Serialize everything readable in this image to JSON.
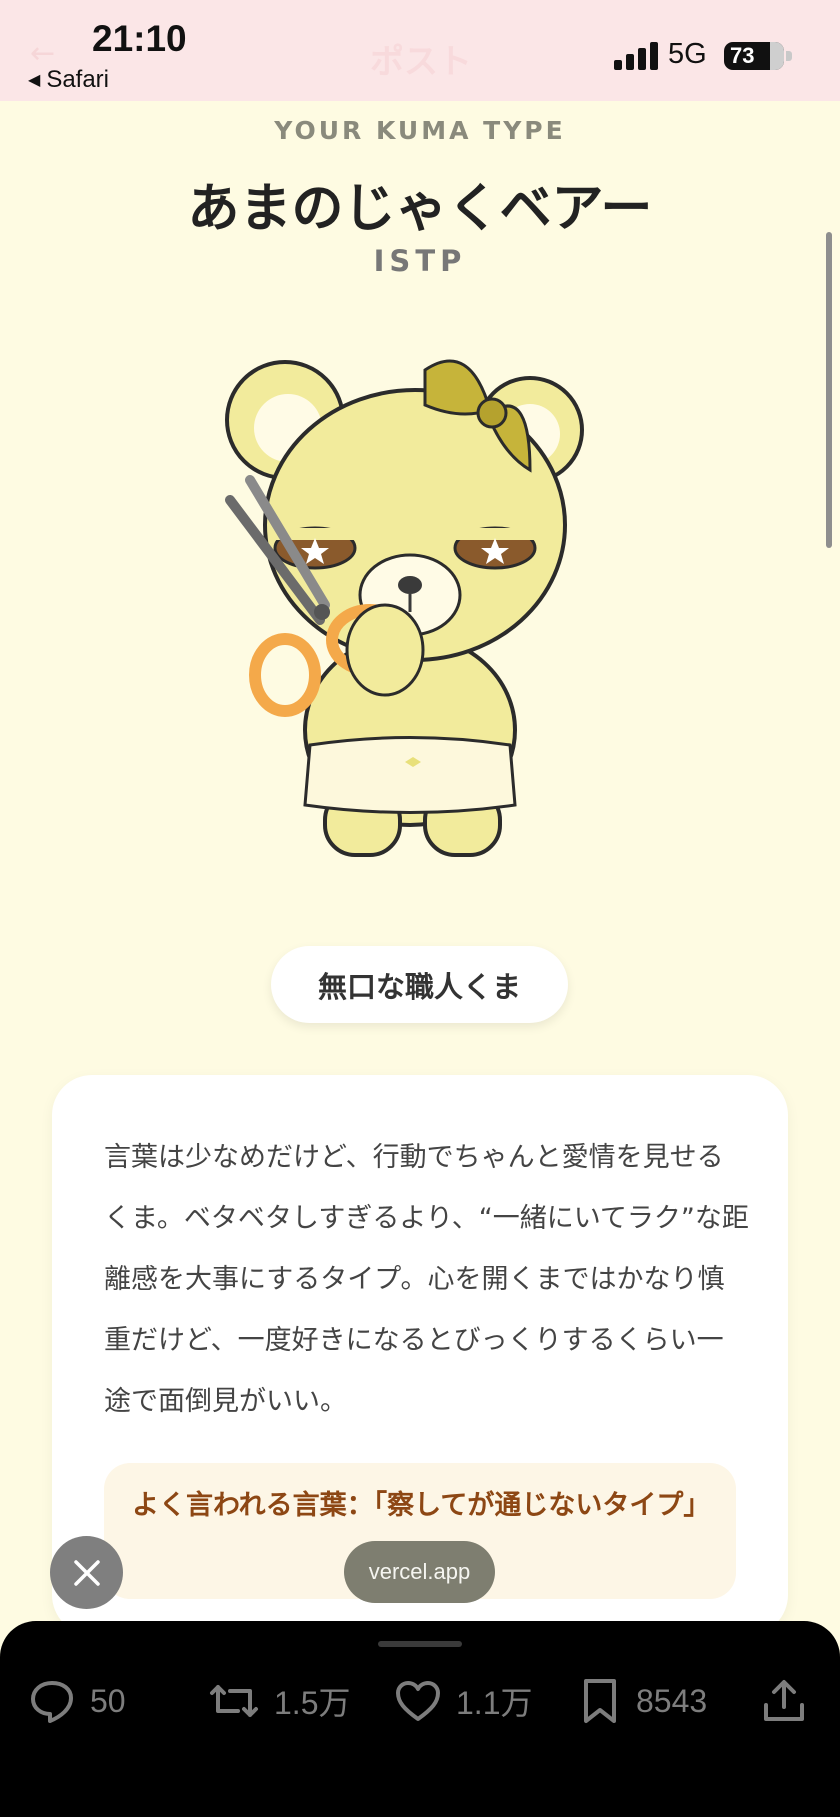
{
  "status_bar": {
    "time": "21:10",
    "back_app": "Safari",
    "faded_title": "ポスト",
    "network": "5G",
    "battery": "73"
  },
  "result": {
    "kicker": "YOUR KUMA TYPE",
    "type_name": "あまのじゃくベアー",
    "type_code": "ISTP",
    "nickname": "無口な職人くま",
    "description": "言葉は少なめだけど、行動でちゃんと愛情を見せるくま。ベタベタしすぎるより、“一緒にいてラク”な距離感を大事にするタイプ。心を開くまではかなり慎重だけど、一度好きになるとびっくりするくらい一途で面倒見がいい。",
    "quote": "よく言われる言葉：「察してが通じないタイプ」"
  },
  "browser": {
    "domain": "vercel.app"
  },
  "actions": {
    "replies": "50",
    "reposts": "1.5万",
    "likes": "1.1万",
    "bookmarks": "8543"
  },
  "colors": {
    "background": "#fefbe2",
    "status_bar": "#fbe6e7",
    "quote_text": "#8d4714",
    "bear": "#f2eb9c"
  },
  "icons": [
    "reply-icon",
    "repost-icon",
    "like-icon",
    "bookmark-icon",
    "share-icon",
    "close-icon"
  ]
}
